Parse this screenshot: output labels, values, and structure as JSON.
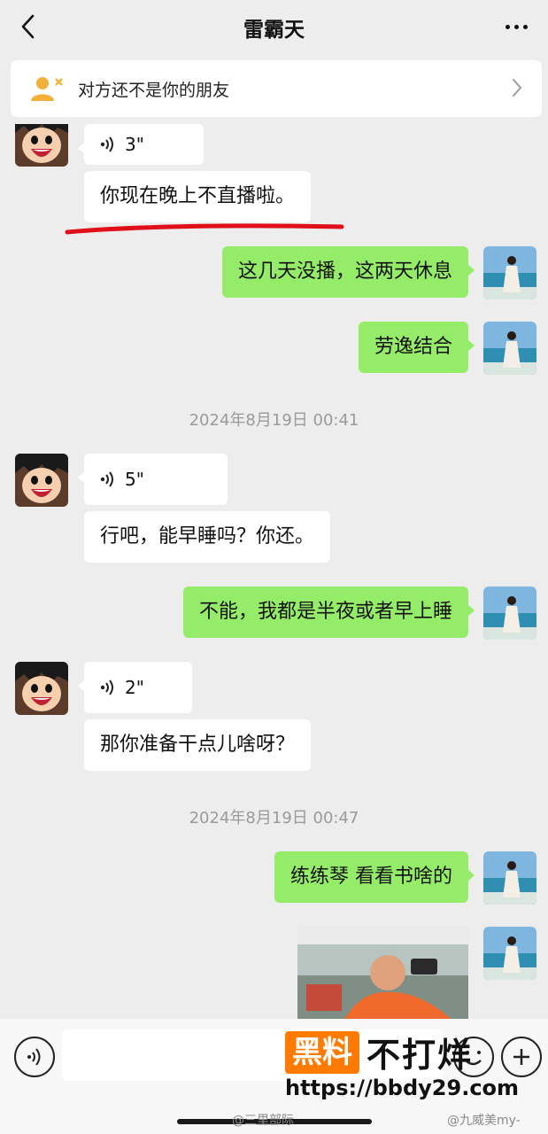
{
  "header": {
    "title": "雷霸天",
    "back_icon": "chevron-left-icon",
    "more_icon": "more-dots-icon"
  },
  "notice": {
    "text": "对方还不是你的朋友",
    "icon": "person-x-icon"
  },
  "messages": [
    {
      "side": "left",
      "type": "voice",
      "duration": "3\""
    },
    {
      "side": "left",
      "type": "text",
      "text": "你现在晚上不直播啦。"
    },
    {
      "side": "right",
      "type": "text",
      "text": "这几天没播，这两天休息"
    },
    {
      "side": "right",
      "type": "text",
      "text": "劳逸结合"
    },
    {
      "type": "timestamp",
      "text": "2024年8月19日 00:41"
    },
    {
      "side": "left",
      "type": "voice",
      "duration": "5\""
    },
    {
      "side": "left",
      "type": "text",
      "text": "行吧，能早睡吗？你还。"
    },
    {
      "side": "right",
      "type": "text",
      "text": "不能，我都是半夜或者早上睡"
    },
    {
      "side": "left",
      "type": "voice",
      "duration": "2\""
    },
    {
      "side": "left",
      "type": "text",
      "text": "那你准备干点儿啥呀？"
    },
    {
      "type": "timestamp",
      "text": "2024年8月19日 00:47"
    },
    {
      "side": "right",
      "type": "text",
      "text": "练练琴 看看书啥的"
    },
    {
      "side": "right",
      "type": "image"
    }
  ],
  "input_bar": {
    "voice_icon": "voice-toggle-icon",
    "emoji_icon": "emoji-icon",
    "plus_icon": "plus-icon"
  },
  "watermark": {
    "box_text": "黑料",
    "text": "不打烊",
    "url": "https://bbdy29.com",
    "credit_left": "@三里部际",
    "credit_right": "@九威美my-"
  },
  "colors": {
    "background": "#ededed",
    "bubble_self": "#95ec69",
    "bubble_other": "#ffffff",
    "underline": "#e0101a",
    "watermark_orange": "#ff7a00"
  }
}
